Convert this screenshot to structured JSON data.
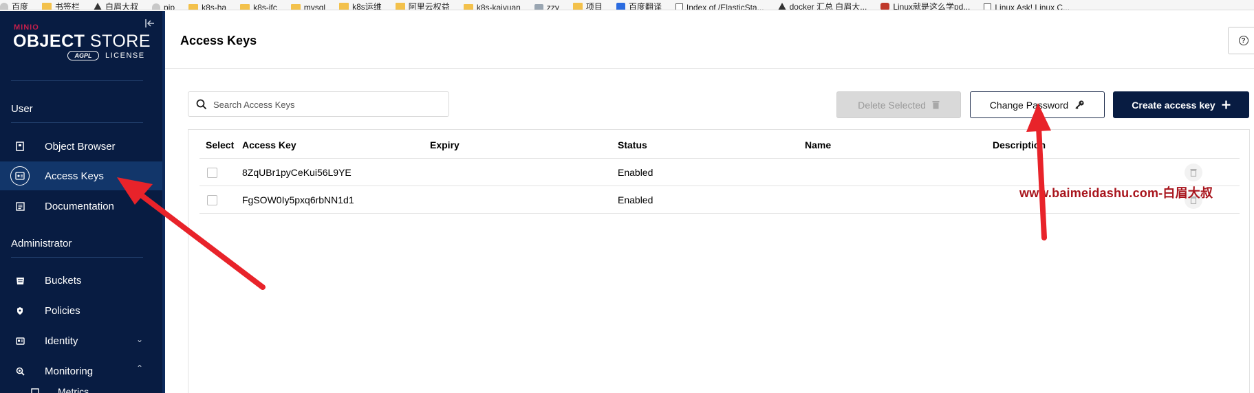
{
  "bookmarks": [
    {
      "label": "百度",
      "icon": "paw-icon"
    },
    {
      "label": "书签栏",
      "icon": "folder-icon"
    },
    {
      "label": "白眉大叔",
      "icon": "triangle-icon"
    },
    {
      "label": "pip",
      "icon": "ghost-icon"
    },
    {
      "label": "k8s-ha",
      "icon": "folder-icon"
    },
    {
      "label": "k8s-jfc",
      "icon": "folder-icon"
    },
    {
      "label": "mysql",
      "icon": "folder-icon"
    },
    {
      "label": "k8s运维",
      "icon": "folder-icon"
    },
    {
      "label": "阿里云权益",
      "icon": "folder-icon"
    },
    {
      "label": "k8s-kaiyuan",
      "icon": "folder-icon"
    },
    {
      "label": "zzy",
      "icon": "grey-icon"
    },
    {
      "label": "项目",
      "icon": "folder-icon"
    },
    {
      "label": "百度翻译",
      "icon": "translate-icon"
    },
    {
      "label": "Index of /ElasticSta...",
      "icon": "document-icon"
    },
    {
      "label": "docker 汇总 白眉大...",
      "icon": "triangle-icon"
    },
    {
      "label": "Linux就是这么学pd...",
      "icon": "red-icon"
    },
    {
      "label": "Linux Ask!  Linux C...",
      "icon": "document-icon"
    }
  ],
  "sidebar": {
    "logo": {
      "brand_small": "MINIO",
      "product_bold": "OBJECT",
      "product_light": "STORE",
      "badge": "AGPL",
      "license": "LICENSE"
    },
    "user_section": "User",
    "user_items": [
      {
        "label": "Object Browser",
        "icon": "object-browser-icon"
      },
      {
        "label": "Access Keys",
        "icon": "access-keys-icon",
        "active": true
      },
      {
        "label": "Documentation",
        "icon": "documentation-icon"
      }
    ],
    "admin_section": "Administrator",
    "admin_items": [
      {
        "label": "Buckets",
        "icon": "buckets-icon"
      },
      {
        "label": "Policies",
        "icon": "policies-icon"
      },
      {
        "label": "Identity",
        "icon": "identity-icon",
        "chevron": "down"
      },
      {
        "label": "Monitoring",
        "icon": "monitoring-icon",
        "chevron": "up"
      },
      {
        "label": "Metrics",
        "icon": "metrics-icon"
      }
    ]
  },
  "header": {
    "title": "Access Keys"
  },
  "toolbar": {
    "search_placeholder": "Search Access Keys",
    "delete_label": "Delete Selected",
    "change_password_label": "Change Password",
    "create_label": "Create access key"
  },
  "table": {
    "columns": [
      "Select",
      "Access Key",
      "Expiry",
      "Status",
      "Name",
      "Description"
    ],
    "rows": [
      {
        "access_key": "8ZqUBr1pyCeKui56L9YE",
        "expiry": "",
        "status": "Enabled",
        "name": "",
        "description": ""
      },
      {
        "access_key": "FgSOW0Iy5pxq6rbNN1d1",
        "expiry": "",
        "status": "Enabled",
        "name": "",
        "description": ""
      }
    ]
  },
  "watermark": "www.baimeidashu.com-白眉大叔",
  "colors": {
    "sidebar_bg": "#081c42",
    "sidebar_active": "#12366a",
    "primary_button": "#081c42",
    "annotation_arrow": "#e8232a",
    "watermark": "#a8141c"
  }
}
